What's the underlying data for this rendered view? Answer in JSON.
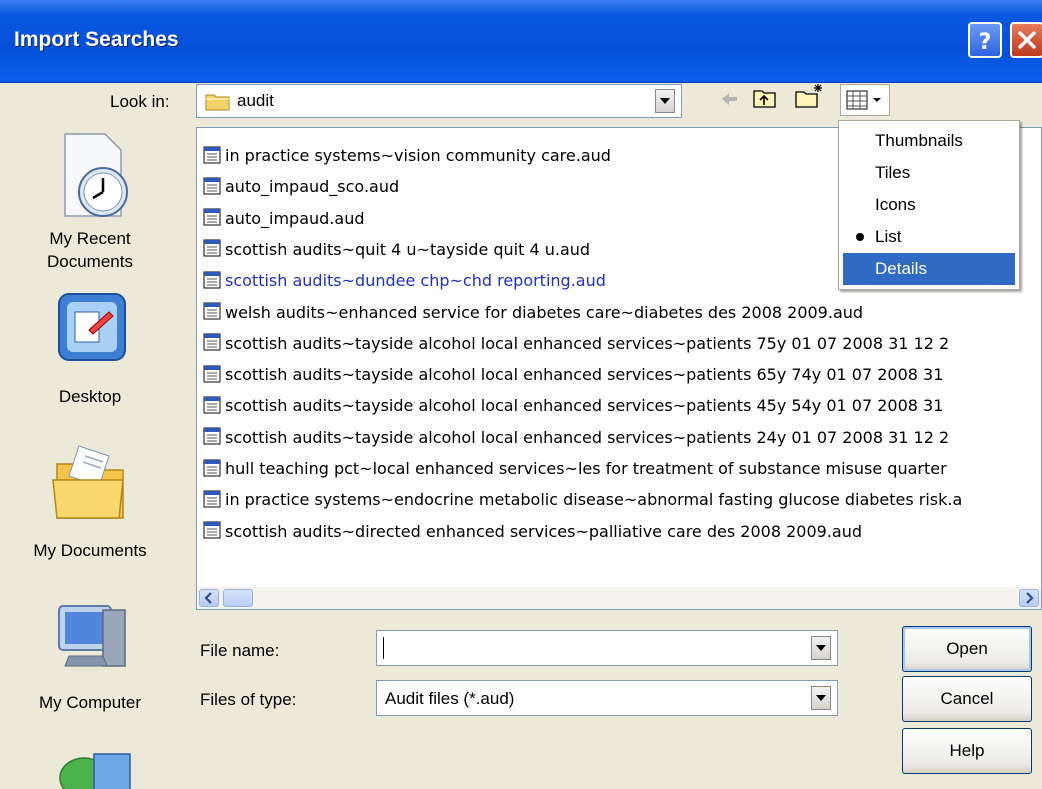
{
  "dialog": {
    "title": "Import Searches"
  },
  "look_in": {
    "label": "Look in:",
    "value": "audit"
  },
  "places": [
    {
      "label": "My Recent Documents"
    },
    {
      "label": "Desktop"
    },
    {
      "label": "My Documents"
    },
    {
      "label": "My Computer"
    }
  ],
  "files": [
    "in practice systems~vision community care.aud",
    "auto_impaud_sco.aud",
    "auto_impaud.aud",
    "scottish audits~quit 4 u~tayside quit 4 u.aud",
    "scottish audits~dundee chp~chd reporting.aud",
    "welsh audits~enhanced service for diabetes care~diabetes des 2008 2009.aud",
    "scottish audits~tayside alcohol local enhanced services~patients 75y 01 07 2008 31 12 2",
    "scottish audits~tayside alcohol local enhanced services~patients 65y 74y 01 07 2008 31",
    "scottish audits~tayside alcohol local enhanced services~patients 45y 54y 01 07 2008 31",
    "scottish audits~tayside alcohol local enhanced services~patients 24y 01 07 2008 31 12 2",
    "hull teaching pct~local enhanced services~les for treatment of substance misuse quarter",
    "in practice systems~endocrine metabolic disease~abnormal fasting glucose diabetes risk.a",
    "scottish audits~directed enhanced services~palliative care des 2008 2009.aud"
  ],
  "view_menu": {
    "items": [
      "Thumbnails",
      "Tiles",
      "Icons",
      "List",
      "Details"
    ],
    "checked": "List",
    "highlighted": "Details"
  },
  "file_name": {
    "label": "File name:",
    "value": ""
  },
  "file_type": {
    "label": "Files of type:",
    "value": "Audit files (*.aud)"
  },
  "buttons": {
    "open": "Open",
    "cancel": "Cancel",
    "help": "Help"
  },
  "colors": {
    "title_bar": "#0550D8",
    "menu_highlight": "#316AC5",
    "selected_text": "#2030C8"
  }
}
